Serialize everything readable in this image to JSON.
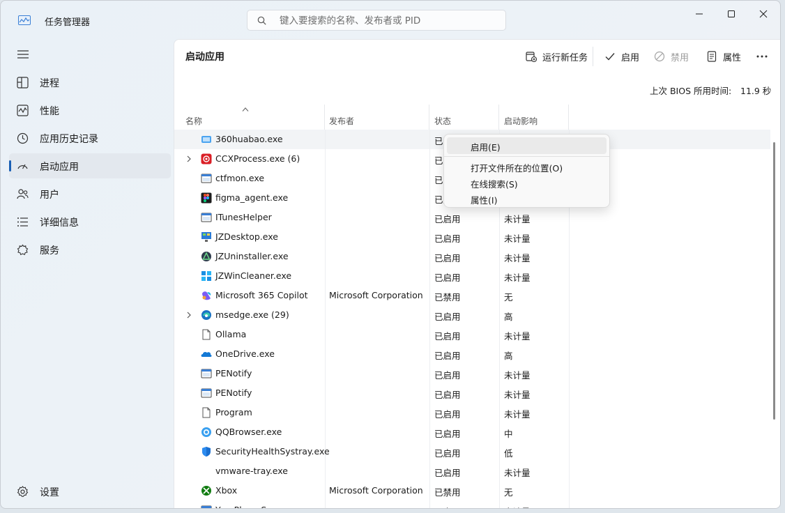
{
  "app": {
    "title": "任务管理器"
  },
  "search": {
    "placeholder": "键入要搜索的名称、发布者或 PID"
  },
  "sidebar": {
    "items": [
      {
        "label": "进程",
        "icon": "processes-icon"
      },
      {
        "label": "性能",
        "icon": "performance-icon"
      },
      {
        "label": "应用历史记录",
        "icon": "app-history-icon"
      },
      {
        "label": "启动应用",
        "icon": "startup-apps-icon",
        "active": true
      },
      {
        "label": "用户",
        "icon": "users-icon"
      },
      {
        "label": "详细信息",
        "icon": "details-icon"
      },
      {
        "label": "服务",
        "icon": "services-icon"
      }
    ],
    "settings_label": "设置"
  },
  "page": {
    "title": "启动应用"
  },
  "toolbar": {
    "run_new_task": "运行新任务",
    "enable": "启用",
    "disable": "禁用",
    "properties": "属性"
  },
  "bios": {
    "label": "上次 BIOS 所用时间:",
    "value": "11.9 秒"
  },
  "columns": {
    "name": "名称",
    "publisher": "发布者",
    "status": "状态",
    "impact": "启动影响"
  },
  "rows": [
    {
      "name": "360huabao.exe",
      "publisher": "",
      "status": "已禁用",
      "impact": "",
      "icon": "360huabao-icon"
    },
    {
      "name": "CCXProcess.exe (6)",
      "publisher": "",
      "status": "已启用",
      "impact": "",
      "icon": "adobe-ccx-icon",
      "expandable": true
    },
    {
      "name": "ctfmon.exe",
      "publisher": "",
      "status": "已启用",
      "impact": "",
      "icon": "app-window-icon"
    },
    {
      "name": "figma_agent.exe",
      "publisher": "",
      "status": "已启用",
      "impact": "",
      "icon": "figma-icon"
    },
    {
      "name": "ITunesHelper",
      "publisher": "",
      "status": "已启用",
      "impact": "未计量",
      "icon": "app-window-icon"
    },
    {
      "name": "JZDesktop.exe",
      "publisher": "",
      "status": "已启用",
      "impact": "未计量",
      "icon": "jzdesktop-icon"
    },
    {
      "name": "JZUninstaller.exe",
      "publisher": "",
      "status": "已启用",
      "impact": "未计量",
      "icon": "jzuninstaller-icon"
    },
    {
      "name": "JZWinCleaner.exe",
      "publisher": "",
      "status": "已启用",
      "impact": "未计量",
      "icon": "jzwincleaner-icon"
    },
    {
      "name": "Microsoft 365 Copilot",
      "publisher": "Microsoft Corporation",
      "status": "已禁用",
      "impact": "无",
      "icon": "m365-copilot-icon"
    },
    {
      "name": "msedge.exe (29)",
      "publisher": "",
      "status": "已启用",
      "impact": "高",
      "icon": "edge-icon",
      "expandable": true
    },
    {
      "name": "Ollama",
      "publisher": "",
      "status": "已启用",
      "impact": "未计量",
      "icon": "file-icon"
    },
    {
      "name": "OneDrive.exe",
      "publisher": "",
      "status": "已启用",
      "impact": "高",
      "icon": "onedrive-icon"
    },
    {
      "name": "PENotify",
      "publisher": "",
      "status": "已启用",
      "impact": "未计量",
      "icon": "app-window-icon"
    },
    {
      "name": "PENotify",
      "publisher": "",
      "status": "已启用",
      "impact": "未计量",
      "icon": "app-window-icon"
    },
    {
      "name": "Program",
      "publisher": "",
      "status": "已启用",
      "impact": "未计量",
      "icon": "file-icon"
    },
    {
      "name": "QQBrowser.exe",
      "publisher": "",
      "status": "已启用",
      "impact": "中",
      "icon": "qqbrowser-icon"
    },
    {
      "name": "SecurityHealthSystray.exe",
      "publisher": "",
      "status": "已启用",
      "impact": "低",
      "icon": "shield-icon"
    },
    {
      "name": "vmware-tray.exe",
      "publisher": "",
      "status": "已启用",
      "impact": "未计量",
      "icon": ""
    },
    {
      "name": "Xbox",
      "publisher": "Microsoft Corporation",
      "status": "已禁用",
      "impact": "无",
      "icon": "xbox-icon"
    },
    {
      "name": "YourPhoneServer",
      "publisher": "",
      "status": "已启用",
      "impact": "未计量",
      "icon": "app-window-icon"
    }
  ],
  "context_menu": {
    "enable": "启用(E)",
    "open_location": "打开文件所在的位置(O)",
    "search_online": "在线搜索(S)",
    "properties": "属性(I)"
  },
  "colors": {
    "accent": "#1a5fb4",
    "panel": "#ffffff",
    "background": "#eaf1f7"
  }
}
